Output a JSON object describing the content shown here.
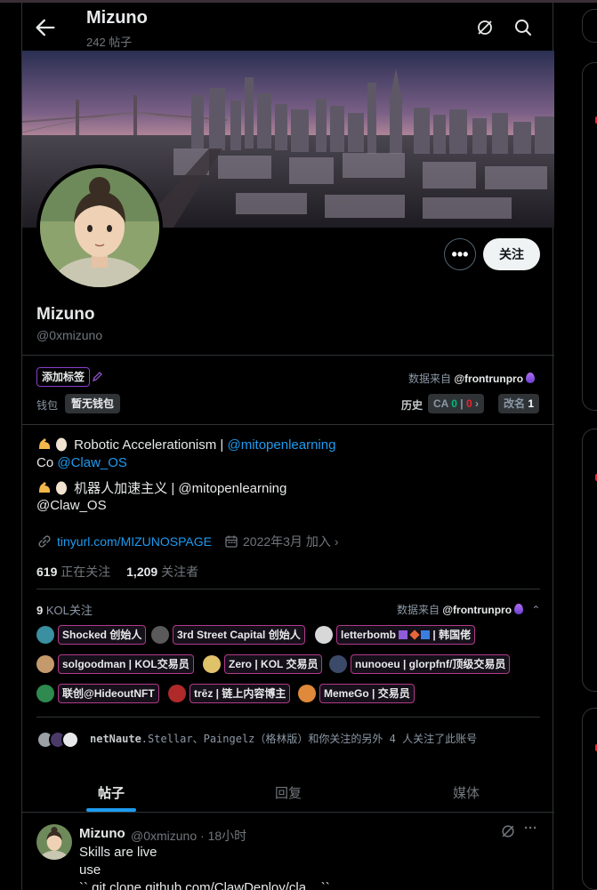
{
  "header": {
    "title": "Mizuno",
    "post_count": "242 帖子"
  },
  "profile": {
    "name": "Mizuno",
    "handle": "@0xmizuno",
    "more_label": "•••",
    "follow_label": "关注"
  },
  "tags": {
    "add_tag_label": "添加标签",
    "source_label": "数据来自",
    "source_handle": "@frontrunpro",
    "wallet_label": "钱包",
    "wallet_value": "暂无钱包",
    "history_label": "历史",
    "ca_label": "CA",
    "ca_green": "0",
    "ca_sep": "|",
    "ca_red": "0",
    "rename_label": "改名",
    "rename_count": "1"
  },
  "bio": {
    "line1_text": "Robotic Accelerationism | ",
    "line1_link": "@mitopenlearning",
    "line2_prefix": "Co ",
    "line2_link": "@Claw_OS",
    "line3_text": "机器人加速主义 | @mitopenlearning",
    "line4_text": "@Claw_OS"
  },
  "meta": {
    "link": "tinyurl.com/MIZUNOSPAGE",
    "joined": "2022年3月 加入"
  },
  "stats": {
    "following_count": "619",
    "following_label": "正在关注",
    "followers_count": "1,209",
    "followers_label": "关注者"
  },
  "kol": {
    "count": "9",
    "title": "KOL关注",
    "source_label": "数据来自",
    "source_handle": "@frontrunpro",
    "items": [
      {
        "label": "Shocked 创始人"
      },
      {
        "label": "3rd Street Capital 创始人"
      },
      {
        "label": "letterbomb",
        "suffix": "| 韩国佬"
      },
      {
        "label": "solgoodman | KOL交易员"
      },
      {
        "label": "Zero | KOL 交易员"
      },
      {
        "label": "nunooeu | glorpfnf/顶级交易员"
      },
      {
        "label": "联创@HideoutNFT"
      },
      {
        "label": "trēz | 链上内容博主"
      },
      {
        "label": "MemeGo | 交易员"
      }
    ]
  },
  "mutual": {
    "names_bold": "netNaute",
    "text": ".Stellar、Paingelz（格林版）和你关注的另外 4 人关注了此账号"
  },
  "tabs": [
    "帖子",
    "回复",
    "媒体"
  ],
  "post": {
    "name": "Mizuno",
    "meta": "@0xmizuno · 18小时",
    "lines": [
      "Skills are live",
      "use",
      "`` git clone github.com/ClawDeploy/cla... ``"
    ]
  },
  "colors": {
    "accent": "#1d9bf0",
    "kol_border": "#b23a8a",
    "tag_border": "#8b3fd0"
  }
}
